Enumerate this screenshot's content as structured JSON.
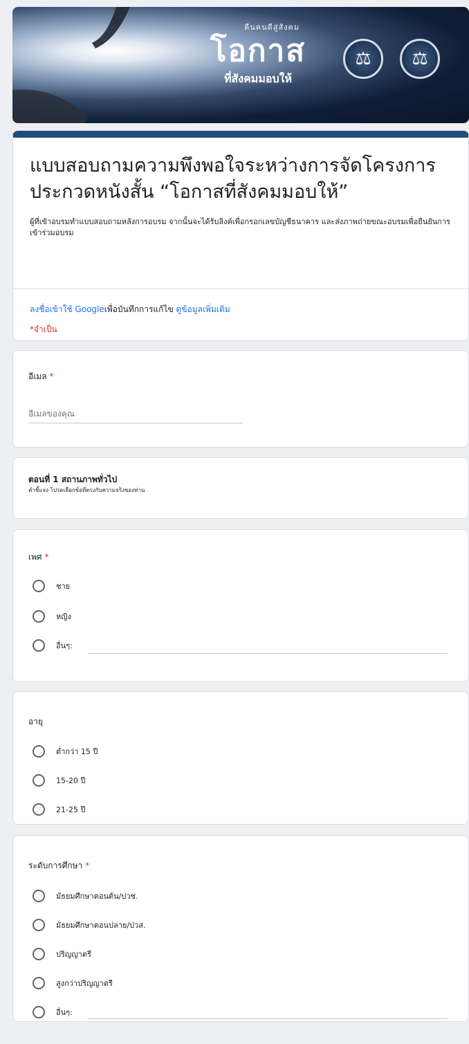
{
  "banner": {
    "tagline": "คืนคนดีสู่สังคม",
    "title": "โอกาส",
    "subtitle": "ที่สังคมมอบให้",
    "seal_icons": [
      "justice-seal-icon",
      "scales-seal-icon"
    ]
  },
  "form": {
    "title": "แบบสอบถามความพึงพอใจระหว่างการจัดโครงการประกวดหนังสั้น “โอกาสที่สังคมมอบให้”",
    "description": "ผู้ที่เข้าอบรมทำแบบสอบถามหลังการอบรม จากนั้นจะได้รับลิงค์เพื่อกรอกเลขบัญชีธนาคาร และส่งภาพถ่ายขณะอบรมเพื่อยืนยันการเข้าร่วมอบรม",
    "signin_link": "ลงชื่อเข้าใช้ Google",
    "signin_text": "เพื่อบันทึกการแก้ไข",
    "learn_more_link": "ดูข้อมูลเพิ่มเติม",
    "required_note": "*จำเป็น"
  },
  "email": {
    "label": "อีเมล",
    "required_mark": "*",
    "placeholder": "อีเมลของคุณ"
  },
  "section1": {
    "title": "ตอนที่ 1 สถานภาพทั่วไป",
    "description": "คำชี้แจง  โปรดเลือกข้อที่ตรงกับความจริงของท่าน"
  },
  "gender": {
    "label": "เพศ",
    "required_mark": "*",
    "options": [
      "ชาย",
      "หญิง",
      "อื่นๆ:"
    ]
  },
  "age": {
    "label": "อายุ",
    "options": [
      "ต่ำกว่า 15 ปี",
      "15-20 ปี",
      "21-25 ปี"
    ]
  },
  "education": {
    "label": "ระดับการศึกษา",
    "required_mark": "*",
    "options": [
      "มัธยมศึกษาตอนต้น/ปวช.",
      "มัธยมศึกษาตอนปลาย/ปวส.",
      "ปริญญาตรี",
      "สูงกว่าปริญญาตรี",
      "อื่นๆ:"
    ]
  },
  "colors": {
    "accent": "#1f4e79",
    "link": "#1a73e8",
    "required": "#d93025",
    "background": "#eeeff3"
  }
}
